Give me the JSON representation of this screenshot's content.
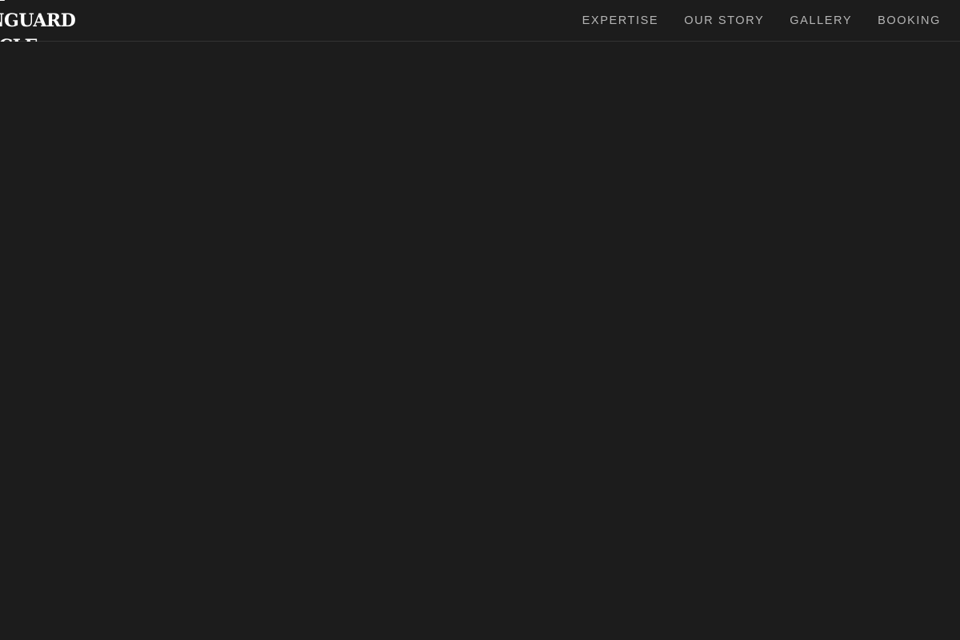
{
  "header": {
    "logo_lines": [
      "THE",
      "VANGUARD",
      "CIRCLE"
    ]
  },
  "nav": {
    "items": [
      {
        "label": "EXPERTISE"
      },
      {
        "label": "OUR STORY"
      },
      {
        "label": "GALLERY"
      },
      {
        "label": "BOOKING"
      }
    ]
  },
  "colors": {
    "background": "#1c1c1c",
    "logo_text": "#ffffff",
    "nav_text": "#b5b5b5",
    "divider": "#333333"
  }
}
